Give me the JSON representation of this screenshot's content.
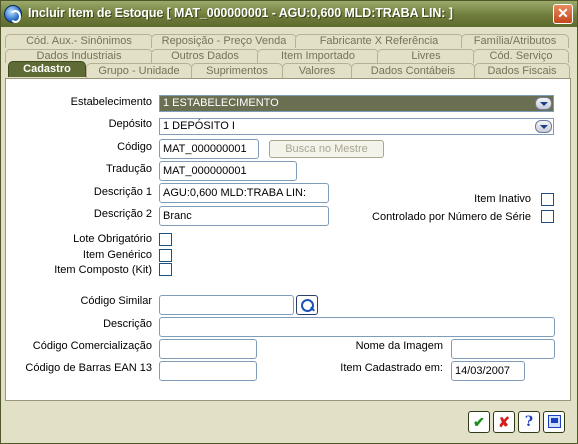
{
  "window": {
    "title": "Incluir Item de Estoque [ MAT_000000001 - AGU:0,600 MLD:TRABA  LIN: ]"
  },
  "tabs": {
    "row1": [
      "Cód. Aux.- Sinônimos",
      "Reposição - Preço Venda",
      "Fabricante X Referência",
      "Família/Atributos"
    ],
    "row2": [
      "Dados Industriais",
      "Outros Dados",
      "Item Importado",
      "Livres",
      "Cód. Serviço"
    ],
    "row3": [
      "Cadastro",
      "Grupo - Unidade",
      "Suprimentos",
      "Valores",
      "Dados Contábeis",
      "Dados Fiscais"
    ]
  },
  "form": {
    "estabelecimento_label": "Estabelecimento",
    "estabelecimento_value": "1 ESTABELECIMENTO",
    "deposito_label": "Depósito",
    "deposito_value": "1 DEPÓSITO I",
    "codigo_label": "Código",
    "codigo_value": "MAT_000000001",
    "busca_label": "Busca no Mestre",
    "traducao_label": "Tradução",
    "traducao_value": "MAT_000000001",
    "descricao1_label": "Descrição 1",
    "descricao1_value": "AGU:0,600 MLD:TRABA  LIN:",
    "descricao2_label": "Descrição 2",
    "descricao2_value": "Branc",
    "item_inativo_label": "Item Inativo",
    "controlado_label": "Controlado por Número de Série",
    "lote_label": "Lote Obrigatório",
    "generico_label": "Item Genérico",
    "composto_label": "Item Composto (Kit)",
    "similar_label": "Código Similar",
    "descricao_label": "Descrição",
    "comercializacao_label": "Código Comercialização",
    "imagem_label": "Nome da Imagem",
    "ean_label": "Código de Barras EAN 13",
    "cadastrado_label": "Item Cadastrado em:",
    "cadastrado_value": "14/03/2007"
  },
  "footer": {
    "ok": "✔",
    "cancel": "✘",
    "help": "?"
  }
}
